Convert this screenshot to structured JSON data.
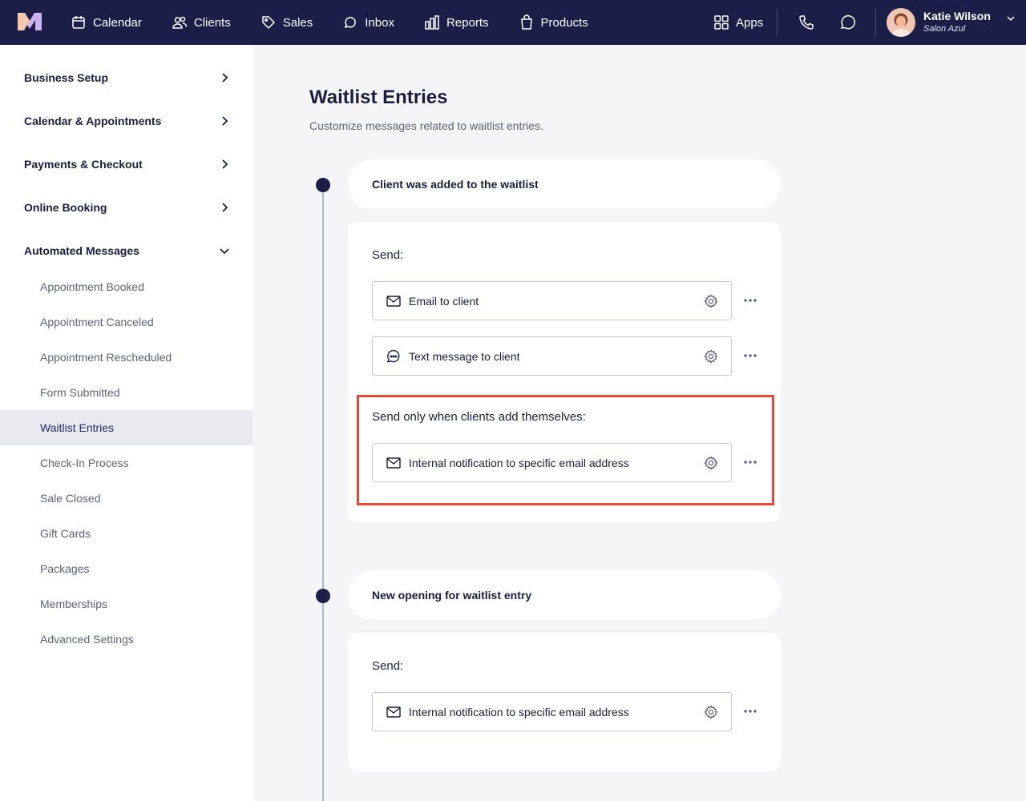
{
  "nav": {
    "items": [
      {
        "label": "Calendar",
        "icon": "calendar-icon"
      },
      {
        "label": "Clients",
        "icon": "clients-icon"
      },
      {
        "label": "Sales",
        "icon": "tag-icon"
      },
      {
        "label": "Inbox",
        "icon": "inbox-icon"
      },
      {
        "label": "Reports",
        "icon": "bar-chart-icon"
      },
      {
        "label": "Products",
        "icon": "shopping-bag-icon"
      }
    ],
    "apps_label": "Apps",
    "user": {
      "name": "Katie Wilson",
      "business": "Salon Azul"
    }
  },
  "sidebar": {
    "sections": [
      {
        "label": "Business Setup",
        "expanded": false
      },
      {
        "label": "Calendar & Appointments",
        "expanded": false
      },
      {
        "label": "Payments & Checkout",
        "expanded": false
      },
      {
        "label": "Online Booking",
        "expanded": false
      },
      {
        "label": "Automated Messages",
        "expanded": true
      }
    ],
    "subitems": [
      "Appointment Booked",
      "Appointment Canceled",
      "Appointment Rescheduled",
      "Form Submitted",
      "Waitlist Entries",
      "Check-In Process",
      "Sale Closed",
      "Gift Cards",
      "Packages",
      "Memberships",
      "Advanced Settings"
    ],
    "active_subitem": "Waitlist Entries"
  },
  "main": {
    "title": "Waitlist Entries",
    "subtitle": "Customize messages related to waitlist entries.",
    "events": [
      {
        "title": "Client was added to the waitlist",
        "send_label": "Send:",
        "messages": [
          {
            "label": "Email to client",
            "icon": "mail-icon"
          },
          {
            "label": "Text message to client",
            "icon": "chat-bubble-icon"
          }
        ],
        "conditional_label": "Send only when clients add themselves:",
        "conditional_messages": [
          {
            "label": "Internal notification to specific email address",
            "icon": "mail-icon"
          }
        ]
      },
      {
        "title": "New opening for waitlist entry",
        "send_label": "Send:",
        "messages": [
          {
            "label": "Internal notification to specific email address",
            "icon": "mail-icon"
          }
        ]
      }
    ]
  },
  "colors": {
    "nav_bg": "#1b1e47",
    "page_bg": "#f5f5f7",
    "highlight": "#e34b34",
    "active_item_bg": "#e9eaef"
  }
}
